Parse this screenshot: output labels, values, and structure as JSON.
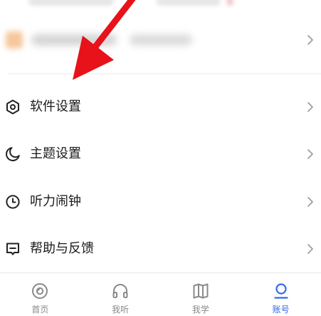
{
  "menu": {
    "items": [
      {
        "label": "软件设置",
        "icon": "settings-hexagon-icon"
      },
      {
        "label": "主题设置",
        "icon": "moon-icon"
      },
      {
        "label": "听力闹钟",
        "icon": "clock-icon"
      },
      {
        "label": "帮助与反馈",
        "icon": "feedback-icon"
      }
    ]
  },
  "tabbar": {
    "tabs": [
      {
        "label": "首页",
        "icon": "home-disc-icon",
        "active": false
      },
      {
        "label": "我听",
        "icon": "headphones-icon",
        "active": false
      },
      {
        "label": "我学",
        "icon": "book-icon",
        "active": false
      },
      {
        "label": "账号",
        "icon": "user-icon",
        "active": true
      }
    ]
  },
  "colors": {
    "accent": "#2f6bf0",
    "text": "#1a1a1a",
    "muted": "#8a8a8a",
    "annotation_arrow": "#e8121a"
  }
}
